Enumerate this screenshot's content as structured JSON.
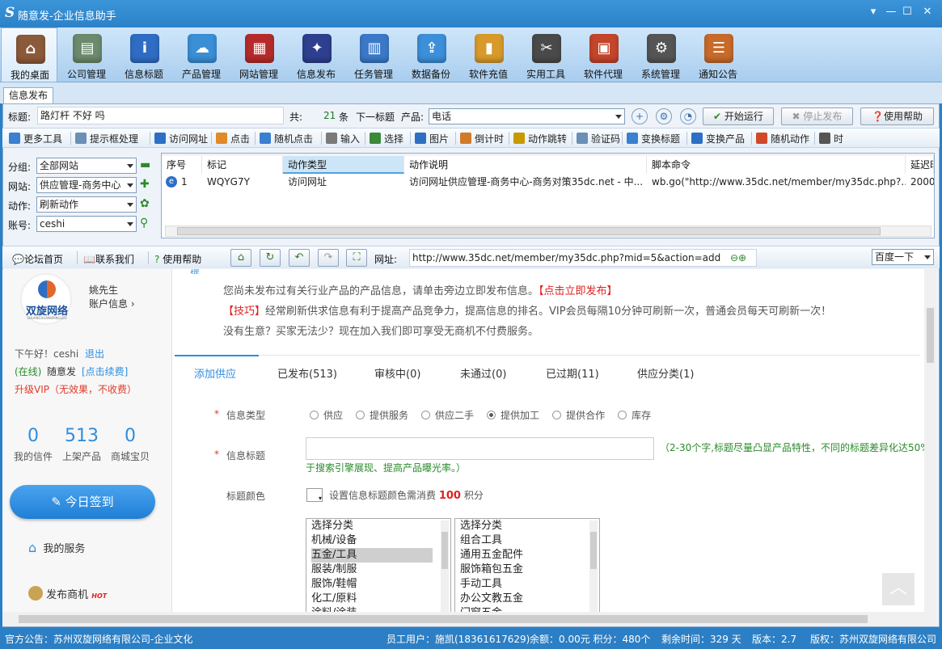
{
  "window": {
    "logo": "S",
    "title": "随意发-企业信息助手",
    "controls": [
      "▾",
      "—",
      "☐",
      "✕"
    ]
  },
  "toolbar": [
    {
      "label": "我的桌面",
      "icon": "home-icon",
      "color": "#8b5a3a",
      "glyph": "⌂"
    },
    {
      "label": "公司管理",
      "icon": "company-icon",
      "color": "#6c8a6c",
      "glyph": "▤"
    },
    {
      "label": "信息标题",
      "icon": "info-icon",
      "color": "#2f6dc4",
      "glyph": "i"
    },
    {
      "label": "产品管理",
      "icon": "product-icon",
      "color": "#3a8fd6",
      "glyph": "☁"
    },
    {
      "label": "网站管理",
      "icon": "website-icon",
      "color": "#b52b2b",
      "glyph": "▦"
    },
    {
      "label": "信息发布",
      "icon": "publish-icon",
      "color": "#2e3f8f",
      "glyph": "✦"
    },
    {
      "label": "任务管理",
      "icon": "task-icon",
      "color": "#3b79c8",
      "glyph": "▥"
    },
    {
      "label": "数据备份",
      "icon": "backup-icon",
      "color": "#3c8fd8",
      "glyph": "⇪"
    },
    {
      "label": "软件充值",
      "icon": "recharge-icon",
      "color": "#d89a2a",
      "glyph": "▮"
    },
    {
      "label": "实用工具",
      "icon": "tools-icon",
      "color": "#4a4a4a",
      "glyph": "✂"
    },
    {
      "label": "软件代理",
      "icon": "agent-icon",
      "color": "#c4452a",
      "glyph": "▣"
    },
    {
      "label": "系统管理",
      "icon": "settings-icon",
      "color": "#555555",
      "glyph": "⚙"
    },
    {
      "label": "通知公告",
      "icon": "notice-icon",
      "color": "#c76a2a",
      "glyph": "☰"
    }
  ],
  "tab": {
    "label": "信息发布"
  },
  "row1": {
    "title_label": "标题:",
    "title_value": "路灯杆 不好 吗",
    "total_label": "共:",
    "total_count": "21",
    "unit": "条",
    "next_label": "下一标题",
    "product_label": "产品:",
    "product_value": "电话",
    "start": "开始运行",
    "stop": "停止发布",
    "help": "使用帮助"
  },
  "commands": [
    "更多工具",
    "提示框处理",
    "访问网址",
    "点击",
    "随机点击",
    "输入",
    "选择",
    "图片",
    "倒计时",
    "动作跳转",
    "验证码",
    "变换标题",
    "变换产品",
    "随机动作",
    "时"
  ],
  "filters": [
    {
      "label": "分组:",
      "value": "全部网站",
      "icon": "folder-icon"
    },
    {
      "label": "网站:",
      "value": "供应管理-商务中心",
      "icon": "add-icon"
    },
    {
      "label": "动作:",
      "value": "刷新动作",
      "icon": "refresh-icon"
    },
    {
      "label": "账号:",
      "value": "ceshi",
      "icon": "search-icon"
    }
  ],
  "grid": {
    "headers": [
      "序号",
      "标记",
      "动作类型",
      "动作说明",
      "脚本命令",
      "延迟时"
    ],
    "rows": [
      [
        "1",
        "WQYG7Y",
        "访问网址",
        "访问网址供应管理-商务中心-商务对策35dc.net - 中...",
        "wb.go(\"http://www.35dc.net/member/my35dc.php?...",
        "2000"
      ]
    ]
  },
  "browser": {
    "forum": "论坛首页",
    "contact": "联系我们",
    "help": "使用帮助",
    "url_label": "网址:",
    "url": "http://www.35dc.net/member/my35dc.php?mid=5&action=add",
    "search": "百度一下"
  },
  "web": {
    "brand": "双旋网络",
    "brand_sub": "SHUANGXUANWANGLUO",
    "user_name": "姚先生",
    "account_info": "账户信息",
    "greeting": "下午好！ceshi",
    "logout": "退出",
    "online": "(在线)",
    "plan": "随意发",
    "renew": "[点击续费]",
    "vip": "升级VIP（无效果，不收费）",
    "stats": [
      {
        "n": "0",
        "l": "我的信件"
      },
      {
        "n": "513",
        "l": "上架产品"
      },
      {
        "n": "0",
        "l": "商城宝贝"
      }
    ],
    "signin": "今日签到",
    "services": "我的服务",
    "post": "发布商机",
    "hot": "HOT",
    "tip1": "您尚未发布过有关行业产品的产品信息，请单击旁边立即发布信息。",
    "tip1_link": "【点击立即发布】",
    "tip2_prefix": "【技巧】",
    "tip2": "经常刷新供求信息有利于提高产品竞争力，提高信息的排名。VIP会员每隔10分钟可刷新一次，普通会员每天可刷新一次！",
    "tip3": "没有生意？买家无法少？现在加入我们即可享受无商机不付费服务。",
    "tabs": [
      "添加供应",
      "已发布(513)",
      "审核中(0)",
      "未通过(0)",
      "已过期(11)",
      "供应分类(1)"
    ],
    "type_label": "信息类型",
    "types": [
      "供应",
      "提供服务",
      "供应二手",
      "提供加工",
      "提供合作",
      "库存"
    ],
    "selected_type": 3,
    "title_field_label": "信息标题",
    "title_hint": "（2-30个字,标题尽量凸显产品特性，不同的标题差异化达50%",
    "title_hint2": "于搜索引擎展现、提高产品曝光率。）",
    "color_label": "标题颜色",
    "color_hint_a": "设置信息标题颜色需消费",
    "color_cost": "100",
    "color_hint_b": "积分",
    "cat1": [
      "选择分类",
      "机械/设备",
      "五金/工具",
      "服装/制服",
      "服饰/鞋帽",
      "化工/原料",
      "涂料/涂装"
    ],
    "cat1_selected": 2,
    "cat2": [
      "选择分类",
      "组合工具",
      "通用五金配件",
      "服饰箱包五金",
      "手动工具",
      "办公文教五金",
      "门窗五金"
    ]
  },
  "status": {
    "notice": "官方公告：苏州双旋网络有限公司-企业文化",
    "staff": "员工用户：施凯(18361617629)",
    "balance": "余额：0.00元 积分：480个",
    "remaining": "剩余时间：329 天",
    "version": "版本：2.7",
    "copyright": "版权：苏州双旋网络有限公司"
  }
}
